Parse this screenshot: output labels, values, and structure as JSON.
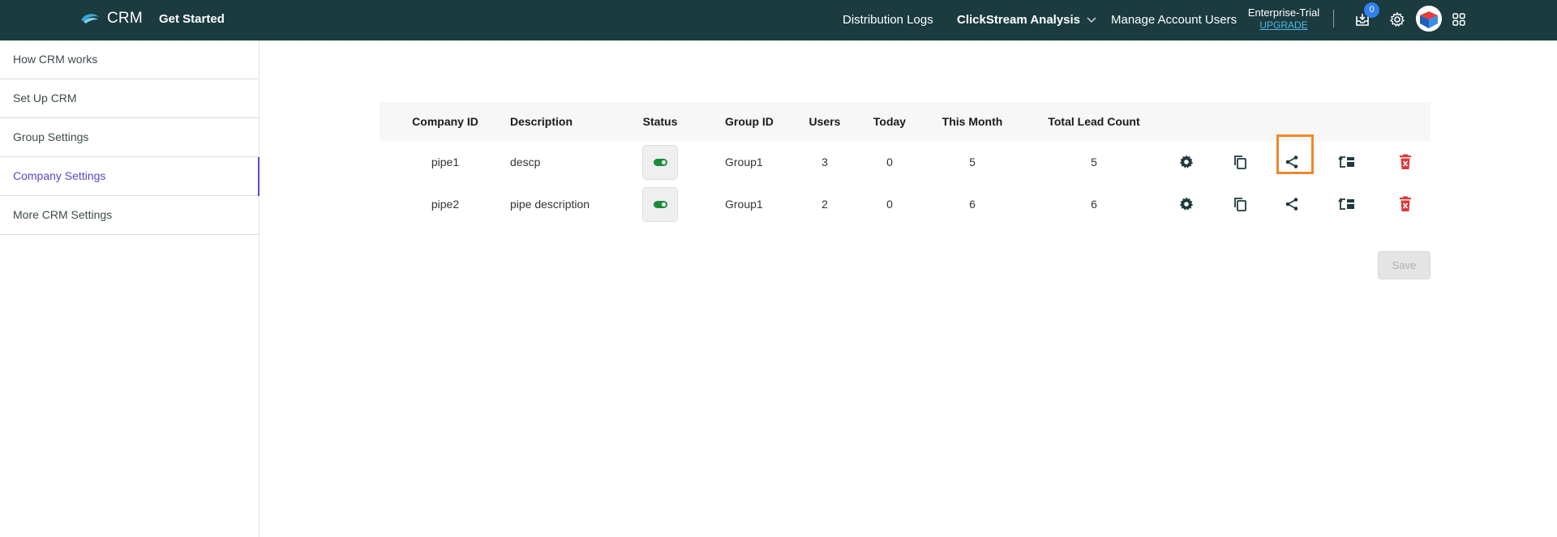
{
  "header": {
    "brand": "CRM",
    "get_started": "Get Started",
    "nav": {
      "distribution_logs": "Distribution Logs",
      "clickstream": "ClickStream Analysis",
      "manage_users": "Manage Account Users"
    },
    "plan": {
      "name": "Enterprise-Trial",
      "upgrade": "UPGRADE"
    },
    "notification_count": "0"
  },
  "sidebar": {
    "items": [
      {
        "label": "How CRM works"
      },
      {
        "label": "Set Up CRM"
      },
      {
        "label": "Group Settings"
      },
      {
        "label": "Company Settings",
        "active": true
      },
      {
        "label": "More CRM Settings"
      }
    ]
  },
  "table": {
    "headers": {
      "company_id": "Company ID",
      "description": "Description",
      "status": "Status",
      "group_id": "Group ID",
      "users": "Users",
      "today": "Today",
      "this_month": "This Month",
      "total_lead_count": "Total Lead Count"
    },
    "rows": [
      {
        "company_id": "pipe1",
        "description": "descp",
        "status": "on",
        "group_id": "Group1",
        "users": "3",
        "today": "0",
        "this_month": "5",
        "total_lead_count": "5"
      },
      {
        "company_id": "pipe2",
        "description": "pipe description",
        "status": "on",
        "group_id": "Group1",
        "users": "2",
        "today": "0",
        "this_month": "6",
        "total_lead_count": "6"
      }
    ]
  },
  "save_label": "Save",
  "colors": {
    "topbar": "#1b3b3f",
    "active_nav": "#5b47c7",
    "toggle_on": "#1b8a3a",
    "delete": "#d93a3a",
    "highlight": "#f0862a",
    "badge": "#2f80ed"
  }
}
